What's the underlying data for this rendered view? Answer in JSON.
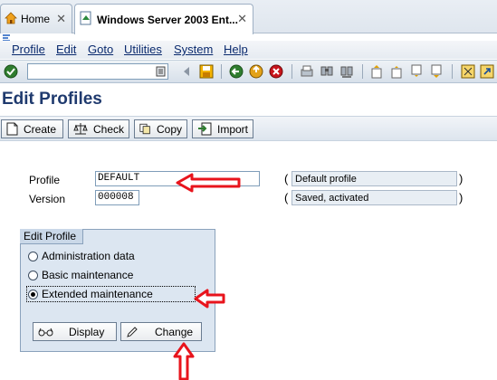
{
  "tabs": [
    {
      "label": "Home",
      "close": "✕"
    },
    {
      "label": "Windows Server 2003 Ent...",
      "close": "✕"
    }
  ],
  "menu": [
    "Profile",
    "Edit",
    "Goto",
    "Utilities",
    "System",
    "Help"
  ],
  "toolbar": {
    "command_value": ""
  },
  "page_title": "Edit Profiles",
  "actions": [
    "Create",
    "Check",
    "Copy",
    "Import"
  ],
  "form": {
    "profile_label": "Profile",
    "profile_value": "DEFAULT",
    "profile_desc": "Default profile",
    "version_label": "Version",
    "version_value": "000008",
    "version_desc": "Saved, activated",
    "paren_open": "(",
    "paren_close": ")"
  },
  "edit_profile": {
    "title": "Edit Profile",
    "options": [
      "Administration data",
      "Basic maintenance",
      "Extended maintenance"
    ],
    "selected": "Extended maintenance",
    "display_button": "Display",
    "change_button": "Change"
  },
  "colors": {
    "annotation_arrow": "#e8141c",
    "title": "#1f3a6e"
  }
}
